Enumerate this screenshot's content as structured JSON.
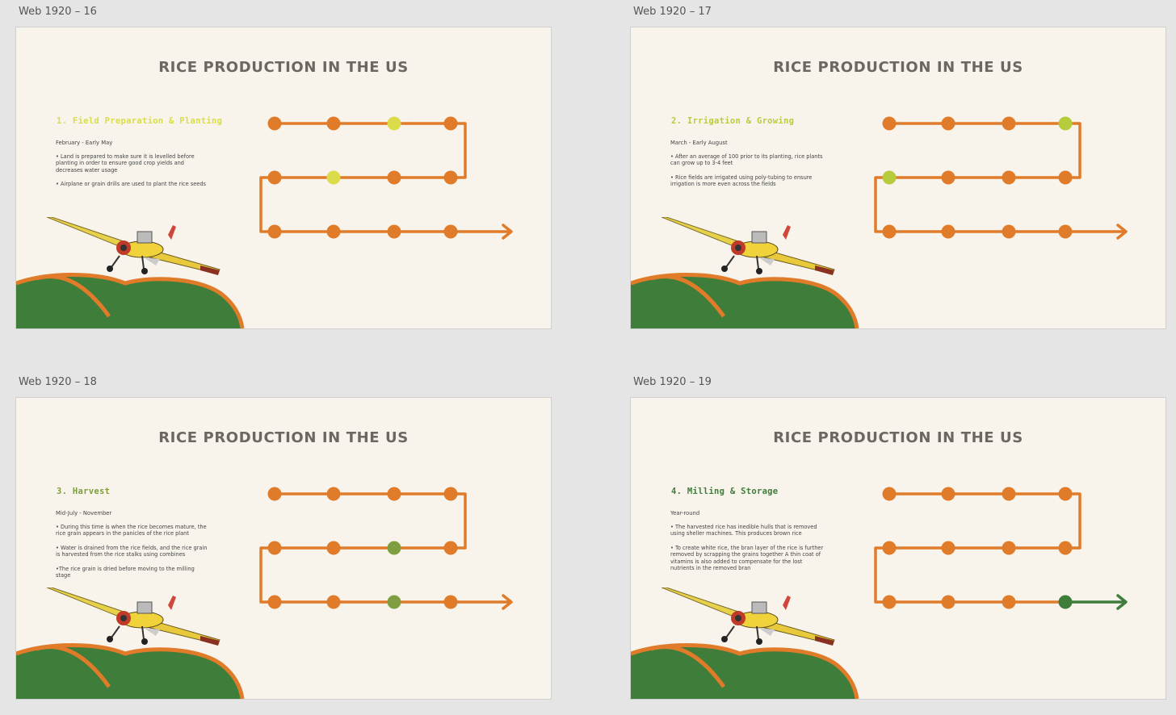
{
  "artboards": [
    {
      "label": "Web 1920 – 16",
      "title": "RICE PRODUCTION IN THE US",
      "step_title": "1. Field Preparation & Planting",
      "step_color": "#d9dd47",
      "date": "February - Early May",
      "bullets": [
        "• Land is prepared to make sure it is levelled before planting in order to ensure good crop yields and decreases water usage",
        "• Airplane or grain drills are used to plant the rice seeds"
      ],
      "highlight_dots": [
        2,
        5
      ],
      "highlight_color": "#dcdc4b",
      "arrow_green": false
    },
    {
      "label": "Web 1920 – 17",
      "title": "RICE PRODUCTION IN THE US",
      "step_title": "2. Irrigation & Growing",
      "step_color": "#b7cd3c",
      "date": "March - Early August",
      "bullets": [
        "• After an average of 100 prior to its planting, rice plants can grow up to 3-4 feet",
        "• Rice fields are irrigated using poly-tubing to ensure irrigation is more even across the fields"
      ],
      "highlight_dots": [
        3,
        4
      ],
      "highlight_color": "#b6cc3c",
      "arrow_green": false
    },
    {
      "label": "Web 1920 – 18",
      "title": "RICE PRODUCTION IN THE US",
      "step_title": "3. Harvest",
      "step_color": "#7f9e3a",
      "date": "Mid-July - November",
      "bullets": [
        "• During this time is when the rice becomes mature, the rice grain appears in the panicles of the rice plant",
        "• Water is drained from the rice fields, and the rice grain is harvested from the rice stalks using combines",
        "•The rice grain is dried before moving to the milling stage"
      ],
      "highlight_dots": [
        6,
        10
      ],
      "highlight_color": "#7f9e40",
      "arrow_green": false
    },
    {
      "label": "Web 1920 – 19",
      "title": "RICE PRODUCTION IN THE US",
      "step_title": "4. Milling & Storage",
      "step_color": "#3e7d3a",
      "date": "Year-round",
      "bullets": [
        "• The harvested rice has inedible hulls that is removed using sheller machines. This produces brown rice",
        "• To create white rice, the bran layer of the rice is further removed by scrapping the grains together A thin coat of vitamins is also added to compensate for the lost nutrients in the removed bran"
      ],
      "highlight_dots": [
        11
      ],
      "highlight_color": "#3e7d3a",
      "arrow_green": true
    }
  ],
  "colors": {
    "background": "#e5e5e5",
    "slide_bg": "#f8f4ec",
    "road_orange": "#e07b2a",
    "hill_green": "#3e7d3a",
    "title_gray": "#6b6763",
    "body_text": "#444444"
  },
  "icons": [
    "crop-duster-plane-illustration",
    "green-hills-illustration",
    "timeline-arrow-icon"
  ]
}
